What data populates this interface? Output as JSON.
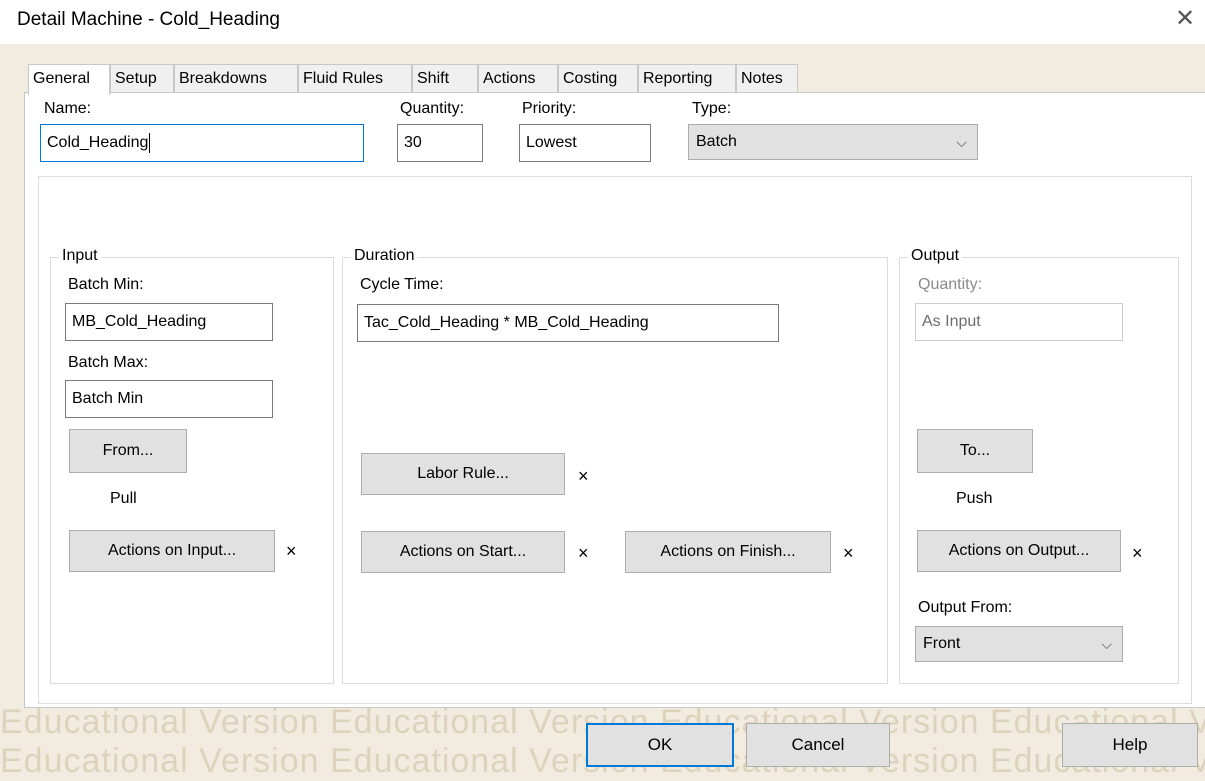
{
  "window": {
    "title": "Detail Machine - Cold_Heading",
    "close_glyph": "✕"
  },
  "watermark": {
    "line1": "Educational Version  Educational Version  Educational Version  Educational Ve",
    "line2": "Educational Version  Educational Version  Educational Version  Educational Ve"
  },
  "tabs": [
    "General",
    "Setup",
    "Breakdowns",
    "Fluid Rules",
    "Shift",
    "Actions",
    "Costing",
    "Reporting",
    "Notes"
  ],
  "general": {
    "name_label": "Name:",
    "name_value": "Cold_Heading",
    "quantity_label": "Quantity:",
    "quantity_value": "30",
    "priority_label": "Priority:",
    "priority_value": "Lowest",
    "type_label": "Type:",
    "type_value": "Batch"
  },
  "input_group": {
    "title": "Input",
    "batch_min_label": "Batch Min:",
    "batch_min_value": "MB_Cold_Heading",
    "batch_max_label": "Batch Max:",
    "batch_max_value": "Batch Min",
    "from_button": "From...",
    "from_mode": "Pull",
    "actions_button": "Actions on Input...",
    "actions_clear": "×"
  },
  "duration_group": {
    "title": "Duration",
    "cycle_time_label": "Cycle Time:",
    "cycle_time_value": "Tac_Cold_Heading * MB_Cold_Heading",
    "labor_button": "Labor Rule...",
    "labor_clear": "×",
    "start_button": "Actions on Start...",
    "start_clear": "×",
    "finish_button": "Actions on Finish...",
    "finish_clear": "×"
  },
  "output_group": {
    "title": "Output",
    "quantity_label": "Quantity:",
    "quantity_value": "As Input",
    "to_button": "To...",
    "to_mode": "Push",
    "actions_button": "Actions on Output...",
    "actions_clear": "×",
    "output_from_label": "Output From:",
    "output_from_value": "Front"
  },
  "footer": {
    "ok": "OK",
    "cancel": "Cancel",
    "help": "Help"
  },
  "icons": {
    "chevron": "⌵"
  }
}
